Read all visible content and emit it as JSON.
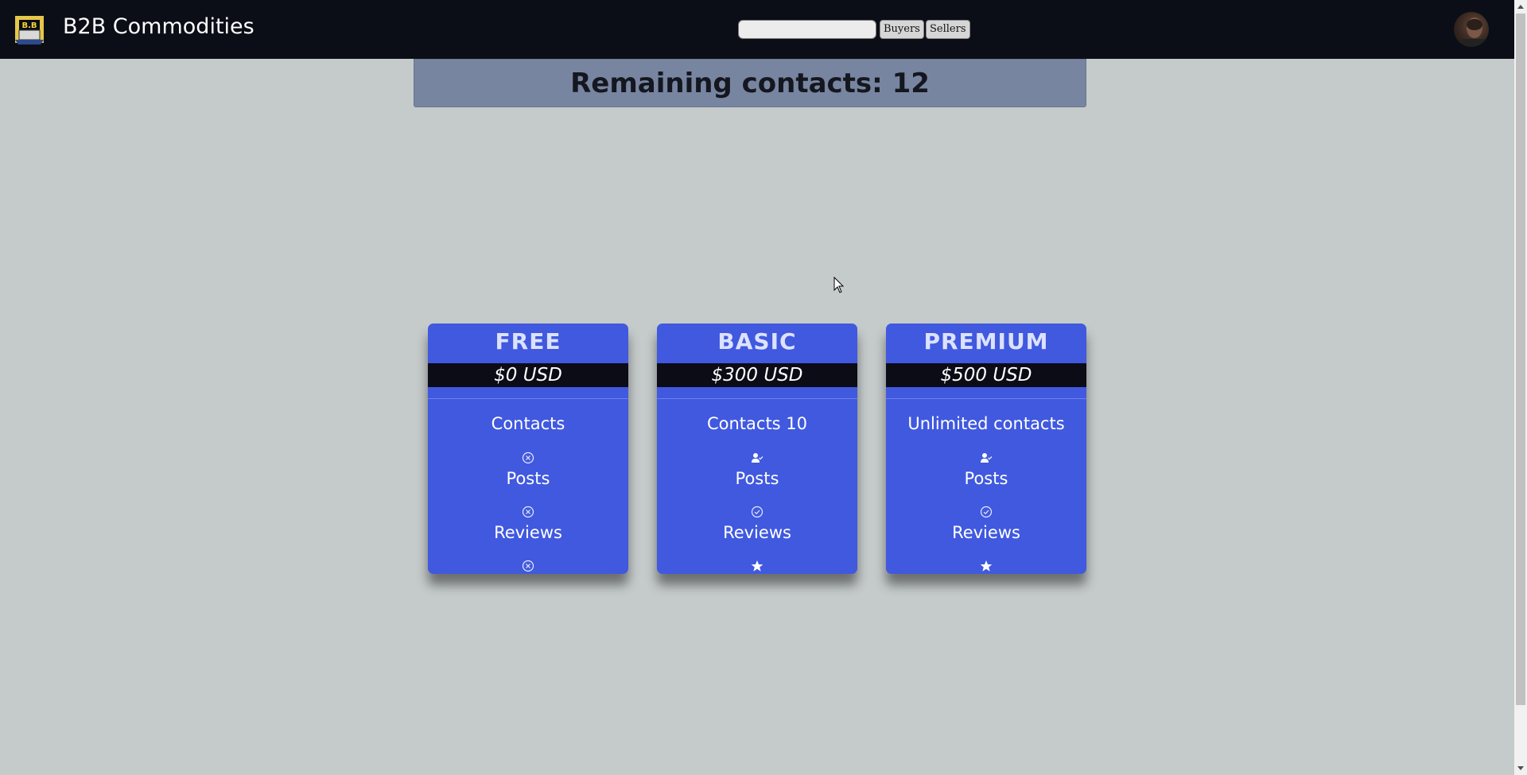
{
  "navbar": {
    "logo_text": "B.B",
    "brand": "B2B Commodities",
    "search": {
      "placeholder": "",
      "value": ""
    },
    "buttons": {
      "buyers": "Buyers",
      "sellers": "Sellers"
    }
  },
  "banner": {
    "text": "Remaining contacts: 12"
  },
  "plans": [
    {
      "name": "FREE",
      "price": "$0 USD",
      "features": [
        {
          "label": "Contacts",
          "icon": "circle-x-icon"
        },
        {
          "label": "Posts",
          "icon": "circle-x-icon"
        },
        {
          "label": "Reviews",
          "icon": "circle-x-icon"
        }
      ]
    },
    {
      "name": "BASIC",
      "price": "$300 USD",
      "features": [
        {
          "label": "Contacts 10",
          "icon": "user-check-icon"
        },
        {
          "label": "Posts",
          "icon": "circle-check-icon"
        },
        {
          "label": "Reviews",
          "icon": "star-icon"
        }
      ]
    },
    {
      "name": "PREMIUM",
      "price": "$500 USD",
      "features": [
        {
          "label": "Unlimited contacts",
          "icon": "user-check-icon"
        },
        {
          "label": "Posts",
          "icon": "circle-check-icon"
        },
        {
          "label": "Reviews",
          "icon": "star-icon"
        }
      ]
    }
  ],
  "colors": {
    "background": "#c5cbcb",
    "navbar": "#0b0e16",
    "banner": "#7885a0",
    "card": "#4059df",
    "price_bar": "#0b0c16"
  }
}
